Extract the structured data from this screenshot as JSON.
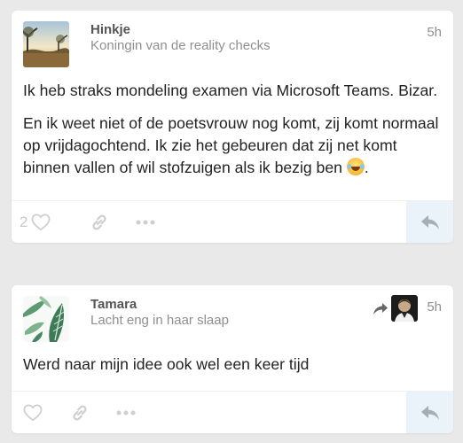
{
  "posts": [
    {
      "username": "Hinkje",
      "user_title": "Koningin van de reality checks",
      "time": "5h",
      "paragraphs": [
        "Ik heb straks mondeling examen via Microsoft Teams. Bizar.",
        "En ik weet niet of de poetsvrouw nog komt, zij komt normaal op vrijdagochtend. Ik zie het gebeuren dat zij net komt binnen vallen of wil stofzuigen als ik bezig ben"
      ],
      "emoji": "joy-emoji",
      "likes": "2"
    },
    {
      "username": "Tamara",
      "user_title": "Lacht eng in haar slaap",
      "time": "5h",
      "paragraphs": [
        "Werd naar mijn idee ook wel een keer tijd"
      ]
    }
  ],
  "icons": [
    "heart-icon",
    "link-icon",
    "more-icon",
    "reply-icon",
    "share-arrow-icon"
  ],
  "colors": {
    "background": "#e9e9e9",
    "reply_bg": "#eaf3f9",
    "muted_icon": "#cfcfcf"
  }
}
